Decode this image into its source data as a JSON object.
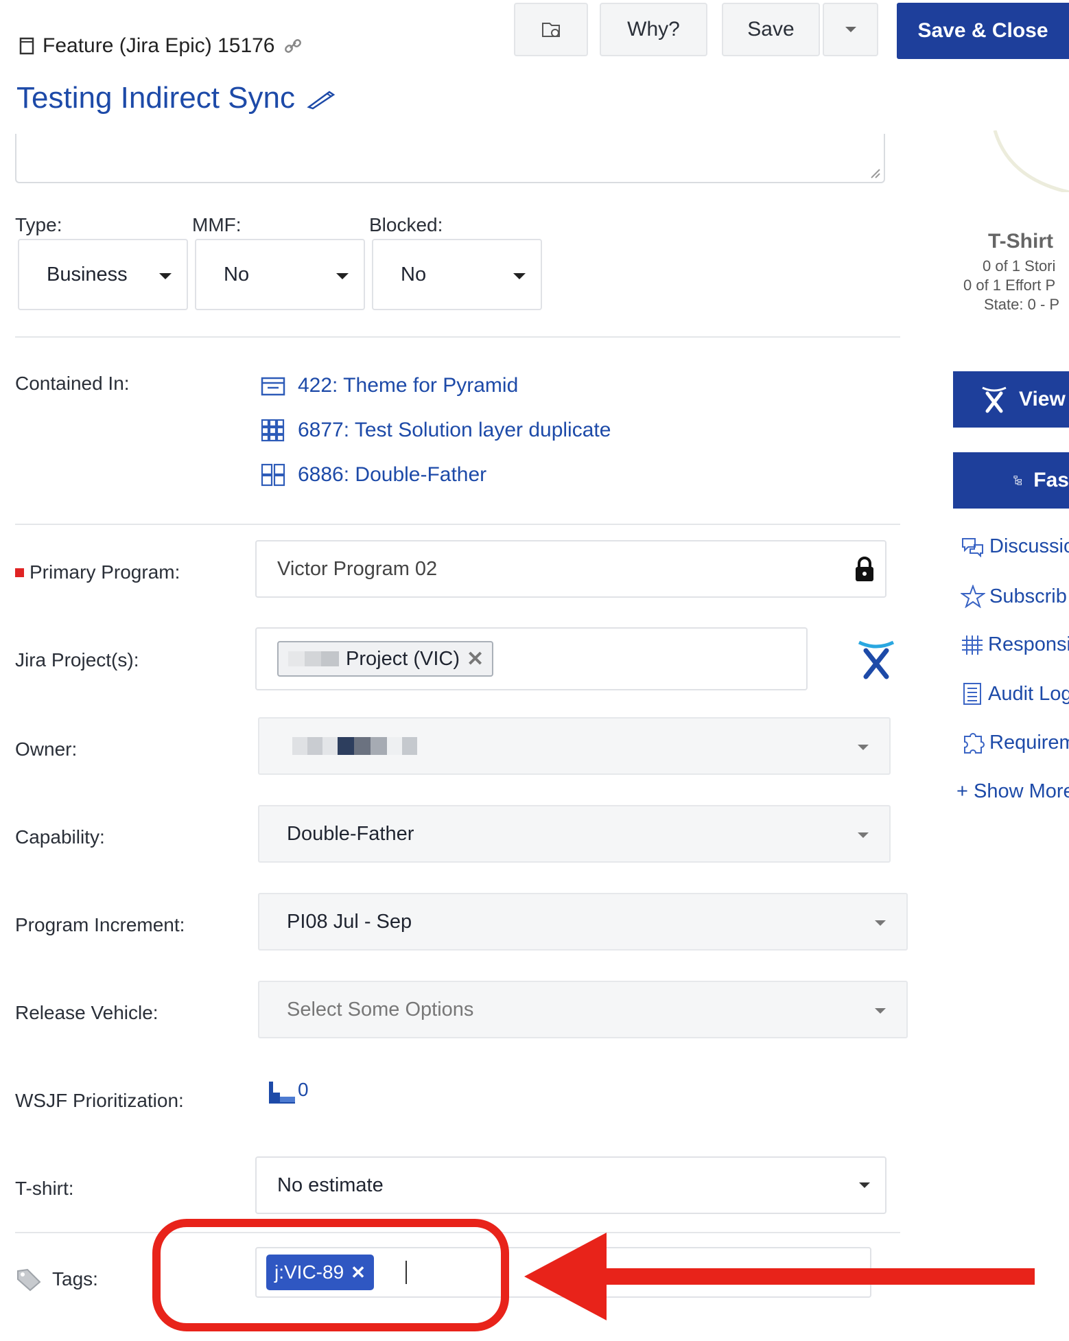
{
  "header": {
    "breadcrumb": "Feature (Jira Epic) 15176",
    "title": "Testing Indirect Sync"
  },
  "toolbar": {
    "why_label": "Why?",
    "save_label": "Save",
    "save_close_label": "Save & Close"
  },
  "classification": {
    "type_label": "Type:",
    "type_value": "Business",
    "mmf_label": "MMF:",
    "mmf_value": "No",
    "blocked_label": "Blocked:",
    "blocked_value": "No"
  },
  "contained_in": {
    "label": "Contained In:",
    "items": [
      {
        "text": "422: Theme for Pyramid",
        "icon": "theme-icon"
      },
      {
        "text": "6877: Test Solution layer duplicate",
        "icon": "grid-icon"
      },
      {
        "text": "6886: Double-Father",
        "icon": "capability-icon"
      }
    ]
  },
  "fields": {
    "primary_program_label": "Primary Program:",
    "primary_program_value": "Victor Program 02",
    "jira_projects_label": "Jira Project(s):",
    "jira_project_tag": "Project (VIC)",
    "owner_label": "Owner:",
    "capability_label": "Capability:",
    "capability_value": "Double-Father",
    "program_increment_label": "Program Increment:",
    "program_increment_value": "PI08 Jul - Sep",
    "release_vehicle_label": "Release Vehicle:",
    "release_vehicle_placeholder": "Select Some Options",
    "wsjf_label": "WSJF Prioritization:",
    "wsjf_value": "0",
    "tshirt_label": "T-shirt:",
    "tshirt_value": "No estimate",
    "tags_label": "Tags:",
    "tag_value": "j:VIC-89"
  },
  "sidebar": {
    "tshirt_heading": "T-Shirt",
    "tshirt_line1": "0 of 1 Stori",
    "tshirt_line2": "0 of 1 Effort P",
    "tshirt_line3": "State: 0 - P",
    "view_button": "View",
    "fast_button": "Fas",
    "links": [
      {
        "label": "Discussio",
        "icon": "discussion-icon"
      },
      {
        "label": "Subscrib",
        "icon": "star-icon"
      },
      {
        "label": "Responsi",
        "icon": "grid-hash-icon"
      },
      {
        "label": "Audit Log",
        "icon": "log-icon"
      },
      {
        "label": "Requirem",
        "icon": "puzzle-icon"
      }
    ],
    "show_more": "+ Show More"
  },
  "colors": {
    "primary_blue": "#1e3f9b",
    "link_blue": "#1d4aa8",
    "annotation_red": "#e8231a",
    "required_marker": "#e02424"
  }
}
